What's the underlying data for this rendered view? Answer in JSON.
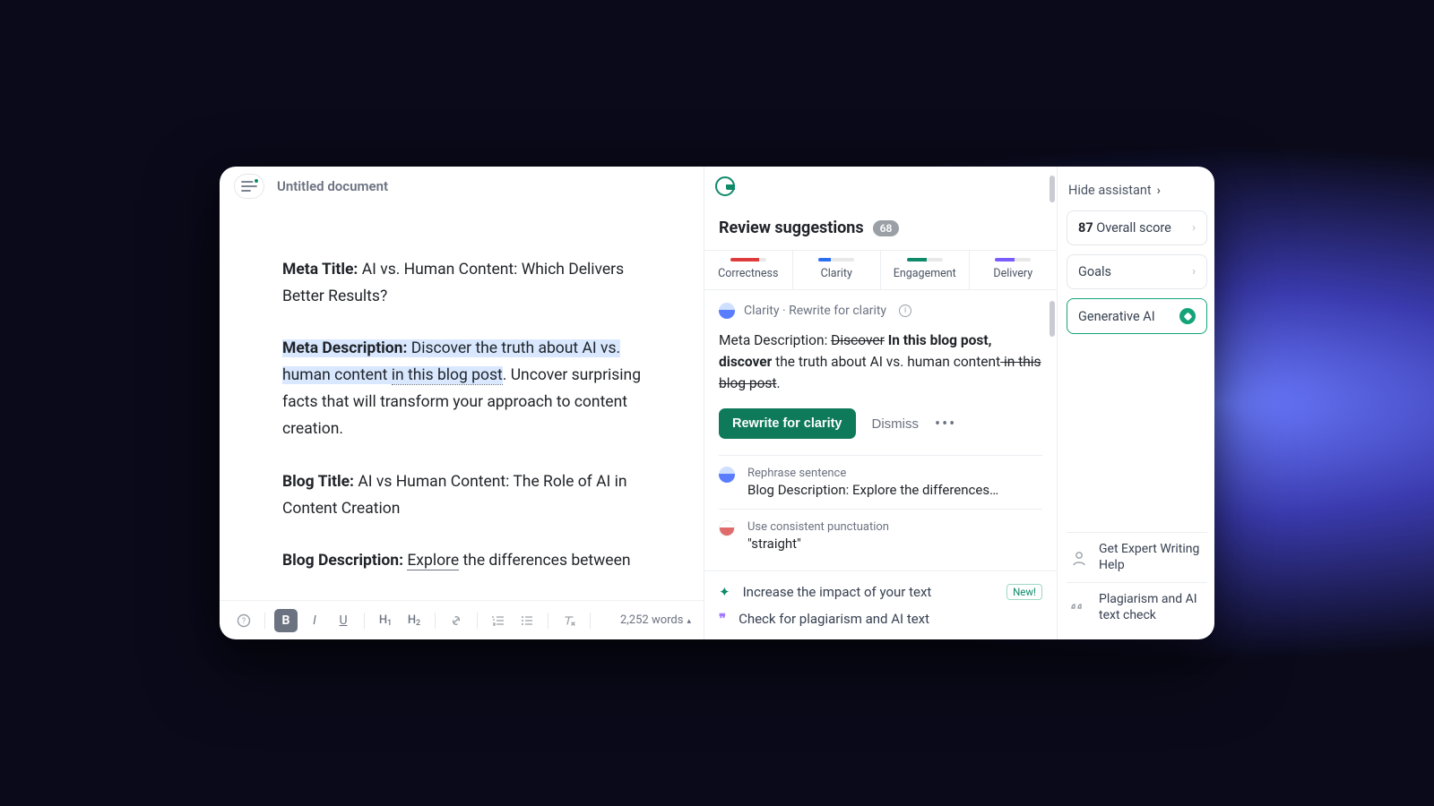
{
  "editor": {
    "doc_title": "Untitled document",
    "meta_title_label": "Meta Title:",
    "meta_title_text": " AI vs. Human Content: Which Delivers Better Results?",
    "meta_desc_label": "Meta Description:",
    "meta_desc_pt1": " Discover the truth about AI vs. human content ",
    "meta_desc_hl": "in this blog post",
    "meta_desc_pt2": ". Uncover surprising facts that will transform your approach to content creation.",
    "blog_title_label": "Blog Title:",
    "blog_title_text": " AI vs Human Content: The Role of AI in Content Creation",
    "blog_desc_label": "Blog Description:",
    "blog_desc_expl": "Explore",
    "blog_desc_rest": " the differences between",
    "toolbar": {
      "h1": "H",
      "h1s": "1",
      "h2": "H",
      "h2s": "2",
      "wc": "2,252 words"
    }
  },
  "assistant": {
    "review_title": "Review suggestions",
    "count": "68",
    "tabs": {
      "correctness": "Correctness",
      "clarity": "Clarity",
      "engagement": "Engagement",
      "delivery": "Delivery"
    },
    "card": {
      "tag": "Clarity · Rewrite for clarity",
      "prefix": "Meta Description: ",
      "strike1": "Discover",
      "bold": " In this blog post, discover",
      "mid": " the truth about AI vs. human content",
      "strike2": " in this blog post",
      "period": ".",
      "primary": "Rewrite for clarity",
      "dismiss": "Dismiss"
    },
    "mini1": {
      "lab": "Rephrase sentence",
      "val": "Blog Description: Explore the differences…"
    },
    "mini2": {
      "lab": "Use consistent punctuation",
      "val": "\"straight\""
    },
    "footer1": "Increase the impact of your text",
    "footer1_badge": "New!",
    "footer2": "Check for plagiarism and AI text"
  },
  "rail": {
    "hide": "Hide assistant",
    "score_n": "87",
    "score_t": " Overall score",
    "goals": "Goals",
    "genai": "Generative AI",
    "help1": "Get Expert Writing Help",
    "help2": "Plagiarism and AI text check"
  }
}
